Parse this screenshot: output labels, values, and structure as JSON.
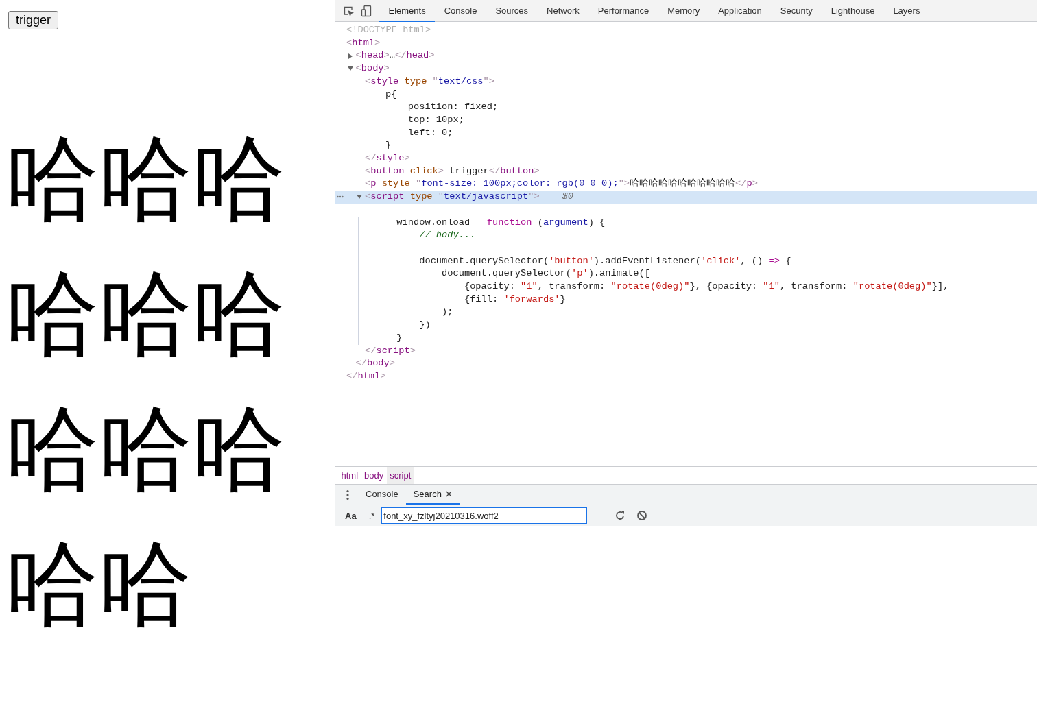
{
  "preview": {
    "button": "trigger",
    "paragraph": "哈哈哈哈哈哈哈哈哈哈哈"
  },
  "devtools": {
    "tabs": [
      {
        "label": "Elements",
        "selected": true
      },
      {
        "label": "Console",
        "selected": false
      },
      {
        "label": "Sources",
        "selected": false
      },
      {
        "label": "Network",
        "selected": false
      },
      {
        "label": "Performance",
        "selected": false
      },
      {
        "label": "Memory",
        "selected": false
      },
      {
        "label": "Application",
        "selected": false
      },
      {
        "label": "Security",
        "selected": false
      },
      {
        "label": "Lighthouse",
        "selected": false
      },
      {
        "label": "Layers",
        "selected": false
      }
    ],
    "dom_tree": [
      {
        "selected": false,
        "tokens": [
          {
            "text": "<!DOCTYPE html>",
            "kind": "doctype"
          }
        ]
      },
      {
        "selected": false,
        "tokens": [
          {
            "text": "<",
            "kind": "punct"
          },
          {
            "text": "html",
            "kind": "tag"
          },
          {
            "text": ">",
            "kind": "punct"
          }
        ],
        "close": [
          {
            "text": "</",
            "kind": "punct"
          },
          {
            "text": "html",
            "kind": "tag"
          },
          {
            "text": ">",
            "kind": "punct"
          }
        ],
        "children": [
          {
            "selected": false,
            "expanded": false,
            "tokens": [
              {
                "text": "<",
                "kind": "punct"
              },
              {
                "text": "head",
                "kind": "tag"
              },
              {
                "text": ">",
                "kind": "punct"
              },
              {
                "text": "…",
                "kind": "plain"
              },
              {
                "text": "</",
                "kind": "punct"
              },
              {
                "text": "head",
                "kind": "tag"
              },
              {
                "text": ">",
                "kind": "punct"
              }
            ]
          },
          {
            "selected": false,
            "expanded": true,
            "tokens": [
              {
                "text": "<",
                "kind": "punct"
              },
              {
                "text": "body",
                "kind": "tag"
              },
              {
                "text": ">",
                "kind": "punct"
              }
            ],
            "close": [
              {
                "text": "</",
                "kind": "punct"
              },
              {
                "text": "body",
                "kind": "tag"
              },
              {
                "text": ">",
                "kind": "punct"
              }
            ],
            "children": [
              {
                "selected": false,
                "tokens": [
                  {
                    "text": "<",
                    "kind": "punct"
                  },
                  {
                    "text": "style",
                    "kind": "tag"
                  },
                  {
                    "text": " type",
                    "kind": "attr"
                  },
                  {
                    "text": "=\"",
                    "kind": "punct"
                  },
                  {
                    "text": "text/css",
                    "kind": "value"
                  },
                  {
                    "text": "\">",
                    "kind": "punct"
                  }
                ],
                "close": [
                  {
                    "text": "</",
                    "kind": "punct"
                  },
                  {
                    "text": "style",
                    "kind": "tag"
                  },
                  {
                    "text": ">",
                    "kind": "punct"
                  }
                ],
                "lines": [
                  {
                    "tokens": [
                      {
                        "text": "  p{",
                        "kind": "plain"
                      }
                    ]
                  },
                  {
                    "tokens": [
                      {
                        "text": "      position: fixed;",
                        "kind": "plain"
                      }
                    ]
                  },
                  {
                    "tokens": [
                      {
                        "text": "      top: 10px;",
                        "kind": "plain"
                      }
                    ]
                  },
                  {
                    "tokens": [
                      {
                        "text": "      left: 0;",
                        "kind": "plain"
                      }
                    ]
                  },
                  {
                    "tokens": [
                      {
                        "text": "  }",
                        "kind": "plain"
                      }
                    ]
                  }
                ]
              },
              {
                "selected": false,
                "tokens": [
                  {
                    "text": "<",
                    "kind": "punct"
                  },
                  {
                    "text": "button",
                    "kind": "tag"
                  },
                  {
                    "text": " click",
                    "kind": "attr"
                  },
                  {
                    "text": ">",
                    "kind": "punct"
                  },
                  {
                    "text": " trigger",
                    "kind": "plain"
                  },
                  {
                    "text": "</",
                    "kind": "punct"
                  },
                  {
                    "text": "button",
                    "kind": "tag"
                  },
                  {
                    "text": ">",
                    "kind": "punct"
                  }
                ]
              },
              {
                "selected": false,
                "tokens": [
                  {
                    "text": "<",
                    "kind": "punct"
                  },
                  {
                    "text": "p",
                    "kind": "tag"
                  },
                  {
                    "text": " style",
                    "kind": "attr"
                  },
                  {
                    "text": "=\"",
                    "kind": "punct"
                  },
                  {
                    "text": "font-size: 100px;color: rgb(0 0 0);",
                    "kind": "value"
                  },
                  {
                    "text": "\">",
                    "kind": "punct"
                  },
                  {
                    "text": "哈哈哈哈哈哈哈哈哈哈哈",
                    "kind": "plain"
                  },
                  {
                    "text": "</",
                    "kind": "punct"
                  },
                  {
                    "text": "p",
                    "kind": "tag"
                  },
                  {
                    "text": ">",
                    "kind": "punct"
                  }
                ]
              },
              {
                "selected": true,
                "expanded": true,
                "tokens": [
                  {
                    "text": "<",
                    "kind": "punct"
                  },
                  {
                    "text": "script",
                    "kind": "tag"
                  },
                  {
                    "text": " type",
                    "kind": "attr"
                  },
                  {
                    "text": "=\"",
                    "kind": "punct"
                  },
                  {
                    "text": "text/javascript",
                    "kind": "value"
                  },
                  {
                    "text": "\">",
                    "kind": "punct"
                  },
                  {
                    "text": " == ",
                    "kind": "punct"
                  },
                  {
                    "text": "$0",
                    "kind": "ref"
                  }
                ],
                "close": [
                  {
                    "text": "</",
                    "kind": "punct"
                  },
                  {
                    "text": "script",
                    "kind": "tag"
                  },
                  {
                    "text": ">",
                    "kind": "punct"
                  }
                ],
                "lines": [
                  {
                    "gap_before": true,
                    "tokens": [
                      {
                        "text": "    window.onload = ",
                        "kind": "plain"
                      },
                      {
                        "text": "function",
                        "kind": "keyword"
                      },
                      {
                        "text": " (",
                        "kind": "plain"
                      },
                      {
                        "text": "argument",
                        "kind": "param"
                      },
                      {
                        "text": ") {",
                        "kind": "plain"
                      }
                    ]
                  },
                  {
                    "tokens": [
                      {
                        "text": "        // body...",
                        "kind": "comment"
                      }
                    ]
                  },
                  {
                    "gap_before": true,
                    "tokens": [
                      {
                        "text": "        document.querySelector(",
                        "kind": "plain"
                      },
                      {
                        "text": "'button'",
                        "kind": "string"
                      },
                      {
                        "text": ").addEventListener(",
                        "kind": "plain"
                      },
                      {
                        "text": "'click'",
                        "kind": "string"
                      },
                      {
                        "text": ", () ",
                        "kind": "plain"
                      },
                      {
                        "text": "=>",
                        "kind": "keyword"
                      },
                      {
                        "text": " {",
                        "kind": "plain"
                      }
                    ]
                  },
                  {
                    "tokens": [
                      {
                        "text": "            document.querySelector(",
                        "kind": "plain"
                      },
                      {
                        "text": "'p'",
                        "kind": "string"
                      },
                      {
                        "text": ").animate([",
                        "kind": "plain"
                      }
                    ]
                  },
                  {
                    "tokens": [
                      {
                        "text": "                {opacity: ",
                        "kind": "plain"
                      },
                      {
                        "text": "\"1\"",
                        "kind": "string"
                      },
                      {
                        "text": ", transform: ",
                        "kind": "plain"
                      },
                      {
                        "text": "\"rotate(0deg)\"",
                        "kind": "string"
                      },
                      {
                        "text": "}, {opacity: ",
                        "kind": "plain"
                      },
                      {
                        "text": "\"1\"",
                        "kind": "string"
                      },
                      {
                        "text": ", transform: ",
                        "kind": "plain"
                      },
                      {
                        "text": "\"rotate(0deg)\"",
                        "kind": "string"
                      },
                      {
                        "text": "}],",
                        "kind": "plain"
                      }
                    ]
                  },
                  {
                    "tokens": [
                      {
                        "text": "                {fill: ",
                        "kind": "plain"
                      },
                      {
                        "text": "'forwards'",
                        "kind": "string"
                      },
                      {
                        "text": "}",
                        "kind": "plain"
                      }
                    ]
                  },
                  {
                    "tokens": [
                      {
                        "text": "            );",
                        "kind": "plain"
                      }
                    ]
                  },
                  {
                    "tokens": [
                      {
                        "text": "        })",
                        "kind": "plain"
                      }
                    ]
                  },
                  {
                    "tokens": [
                      {
                        "text": "    }",
                        "kind": "plain"
                      }
                    ]
                  }
                ]
              }
            ]
          }
        ]
      }
    ],
    "breadcrumbs": [
      {
        "label": "html",
        "selected": false
      },
      {
        "label": "body",
        "selected": false
      },
      {
        "label": "script",
        "selected": true
      }
    ],
    "drawer": {
      "tabs": [
        {
          "label": "Console",
          "selected": false,
          "closable": false
        },
        {
          "label": "Search",
          "selected": true,
          "closable": true
        }
      ],
      "search": {
        "case_toggle": "Aa",
        "regex_toggle": ".*",
        "value": "font_xy_fzltyj20210316.woff2"
      }
    }
  }
}
